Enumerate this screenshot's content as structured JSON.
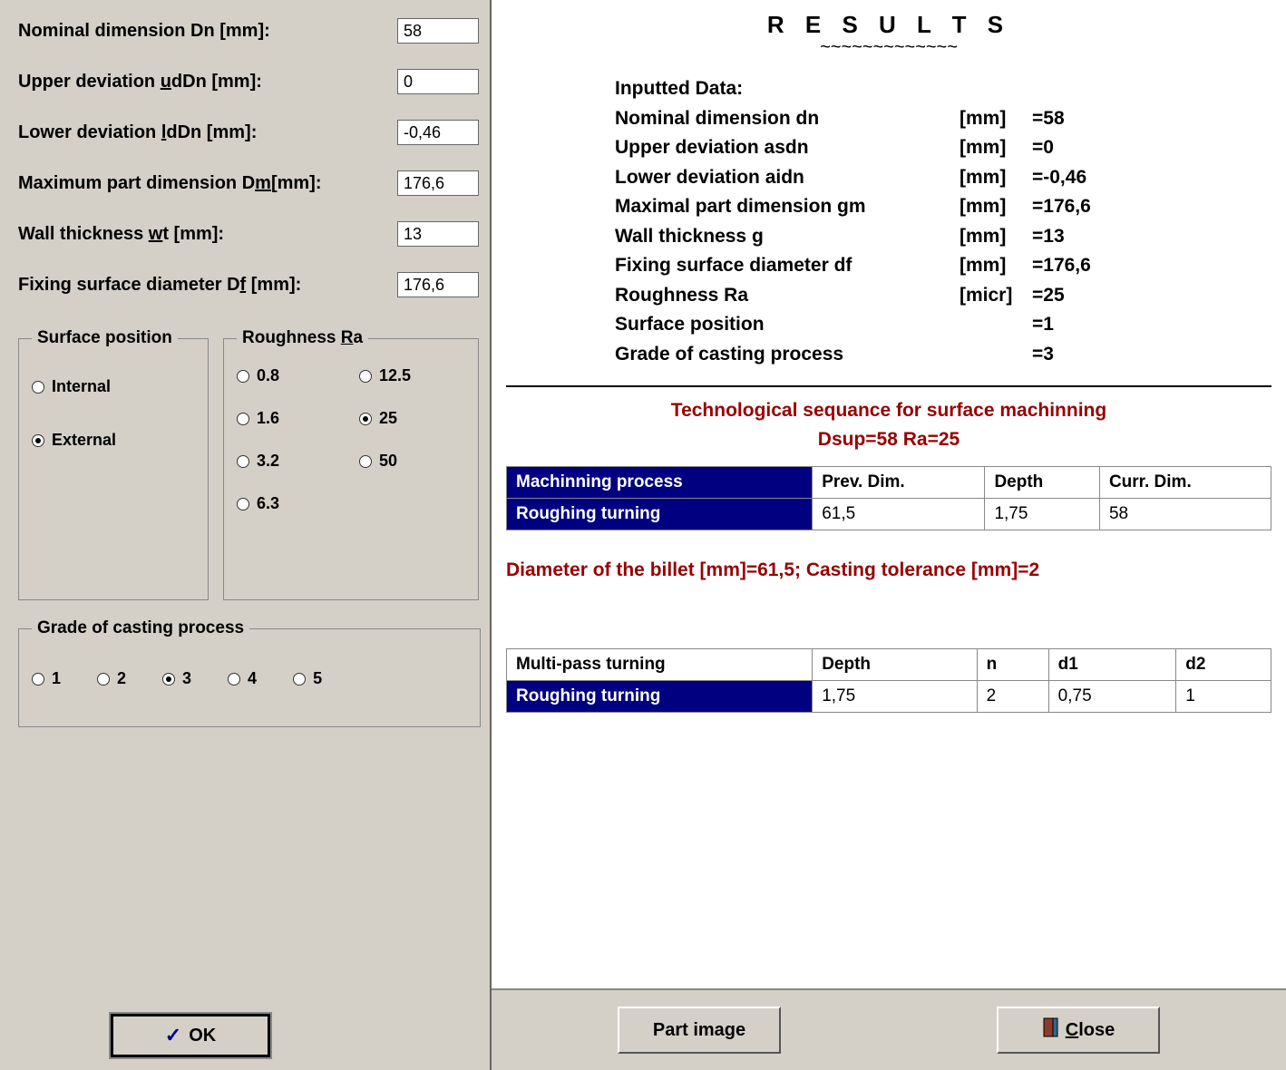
{
  "inputs": {
    "dn_label": "Nominal dimension Dn [mm]:",
    "dn_value": "58",
    "ud_label_pre": "Upper deviation ",
    "ud_label_u": "u",
    "ud_label_post": "dDn [mm]:",
    "ud_value": "0",
    "ld_label_pre": "Lower deviation ",
    "ld_label_u": "l",
    "ld_label_post": "dDn [mm]:",
    "ld_value": "-0,46",
    "dm_label_pre": "Maximum part dimension D",
    "dm_label_u": "m",
    "dm_label_post": "[mm]:",
    "dm_value": "176,6",
    "wt_label_pre": "Wall thickness ",
    "wt_label_u": "w",
    "wt_label_post": "t [mm]:",
    "wt_value": "13",
    "df_label_pre": "Fixing surface diameter D",
    "df_label_u": "f",
    "df_label_post": " [mm]:",
    "df_value": "176,6"
  },
  "surface_position": {
    "legend": "Surface position",
    "options": [
      {
        "label": "Internal",
        "checked": false
      },
      {
        "label": "External",
        "checked": true
      }
    ]
  },
  "roughness": {
    "legend_pre": "Roughness ",
    "legend_u": "R",
    "legend_post": "a",
    "options": [
      {
        "label": "0.8",
        "checked": false
      },
      {
        "label": "12.5",
        "checked": false
      },
      {
        "label": "1.6",
        "checked": false
      },
      {
        "label": "25",
        "checked": true
      },
      {
        "label": "3.2",
        "checked": false
      },
      {
        "label": "50",
        "checked": false
      },
      {
        "label": "6.3",
        "checked": false
      }
    ]
  },
  "grade": {
    "legend": "Grade of casting process",
    "options": [
      {
        "label": "1",
        "checked": false
      },
      {
        "label": "2",
        "checked": false
      },
      {
        "label": "3",
        "checked": true
      },
      {
        "label": "4",
        "checked": false
      },
      {
        "label": "5",
        "checked": false
      }
    ]
  },
  "buttons": {
    "ok": "OK",
    "part_image": "Part image",
    "close": "Close"
  },
  "results": {
    "title": "R E S U L T S",
    "wave": "~~~~~~~~~~~~~",
    "inputted_header": "Inputted Data:",
    "rows": [
      {
        "lab": "Nominal dimension dn",
        "unit": "[mm]",
        "val": "=58"
      },
      {
        "lab": "Upper deviation asdn",
        "unit": "[mm]",
        "val": "=0"
      },
      {
        "lab": "Lower deviation  aidn",
        "unit": "[mm]",
        "val": "=-0,46"
      },
      {
        "lab": "Maximal part dimension gm",
        "unit": "[mm]",
        "val": "=176,6"
      },
      {
        "lab": "Wall thickness g",
        "unit": "[mm]",
        "val": "=13"
      },
      {
        "lab": "Fixing surface diameter  df",
        "unit": "[mm]",
        "val": "=176,6"
      },
      {
        "lab": "Roughness Ra",
        "unit": "[micr]",
        "val": "=25"
      },
      {
        "lab": "Surface position",
        "unit": "",
        "val": "=1"
      },
      {
        "lab": "Grade of casting process",
        "unit": "",
        "val": "=3"
      }
    ],
    "tech_line1": "Technological sequance for surface machinning",
    "tech_line2": "Dsup=58       Ra=25",
    "table1_headers": [
      "Machinning process",
      "Prev. Dim.",
      "Depth",
      "Curr. Dim."
    ],
    "table1_row": [
      "Roughing turning",
      "61,5",
      "1,75",
      "58"
    ],
    "billet_line": "Diameter of the billet [mm]=61,5;   Casting tolerance [mm]=2",
    "table2_headers": [
      "Multi-pass turning",
      "Depth",
      "n",
      "d1",
      "d2"
    ],
    "table2_row": [
      "Roughing turning",
      "1,75",
      "2",
      "0,75",
      "1"
    ]
  }
}
